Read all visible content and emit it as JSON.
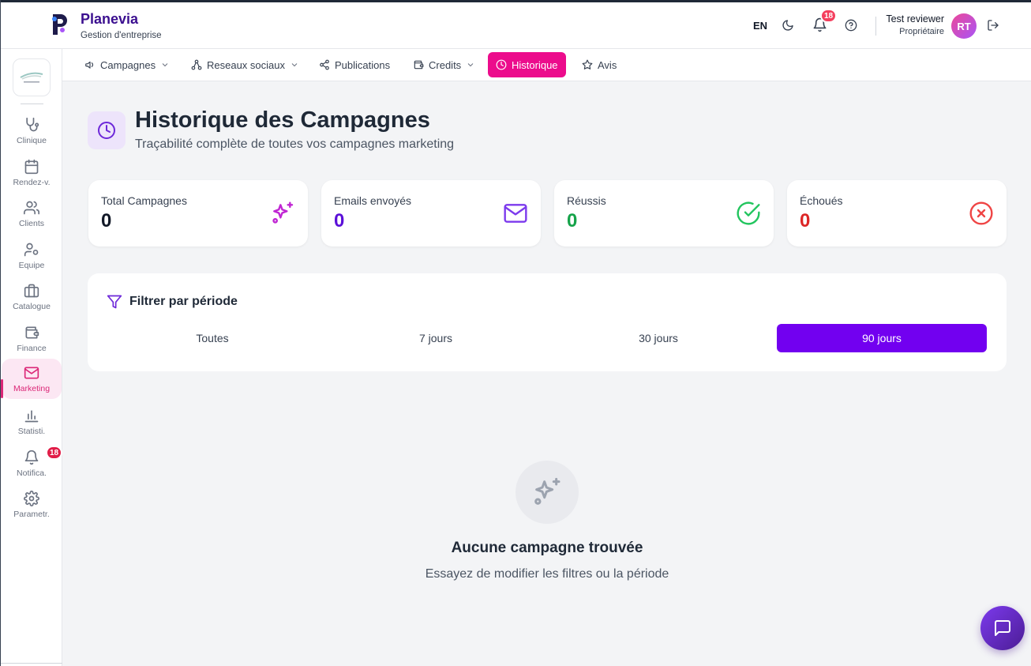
{
  "header": {
    "brand_name": "Planevia",
    "brand_sub": "Gestion d'entreprise",
    "lang": "EN",
    "notif_count": "18",
    "user_name": "Test reviewer",
    "user_role": "Propriétaire",
    "avatar_initials": "RT"
  },
  "sidebar": {
    "items": [
      {
        "label": "Clinique",
        "icon": "stethoscope-icon"
      },
      {
        "label": "Rendez-v.",
        "icon": "calendar-icon"
      },
      {
        "label": "Clients",
        "icon": "users-icon"
      },
      {
        "label": "Equipe",
        "icon": "user-cog-icon"
      },
      {
        "label": "Catalogue",
        "icon": "briefcase-icon"
      },
      {
        "label": "Finance",
        "icon": "wallet-icon"
      },
      {
        "label": "Marketing",
        "icon": "mail-icon"
      },
      {
        "label": "Statisti.",
        "icon": "bar-chart-icon"
      },
      {
        "label": "Notifica.",
        "icon": "bell-icon"
      },
      {
        "label": "Parametr.",
        "icon": "gear-icon"
      }
    ],
    "active": "Marketing",
    "notif_badge": "18"
  },
  "tabs": [
    {
      "label": "Campagnes",
      "icon": "megaphone-icon",
      "dropdown": true
    },
    {
      "label": "Reseaux sociaux",
      "icon": "network-icon",
      "dropdown": true
    },
    {
      "label": "Publications",
      "icon": "share-icon",
      "dropdown": false
    },
    {
      "label": "Credits",
      "icon": "wallet-icon",
      "dropdown": true
    },
    {
      "label": "Historique",
      "icon": "clock-icon",
      "dropdown": false,
      "active": true
    },
    {
      "label": "Avis",
      "icon": "star-icon",
      "dropdown": false
    }
  ],
  "page": {
    "title": "Historique des Campagnes",
    "subtitle": "Traçabilité complète de toutes vos campagnes marketing"
  },
  "stats": [
    {
      "label": "Total Campagnes",
      "value": "0",
      "color": "#111827",
      "icon": "sparkles-icon",
      "icon_color": "#c026d3"
    },
    {
      "label": "Emails envoyés",
      "value": "0",
      "color": "#5b10d8",
      "icon": "mail-icon",
      "icon_color": "#7c3aed"
    },
    {
      "label": "Réussis",
      "value": "0",
      "color": "#16a34a",
      "icon": "check-circle-icon",
      "icon_color": "#22c55e"
    },
    {
      "label": "Échoués",
      "value": "0",
      "color": "#dc2626",
      "icon": "x-circle-icon",
      "icon_color": "#ef4444"
    }
  ],
  "filter": {
    "title": "Filtrer par période",
    "options": [
      "Toutes",
      "7 jours",
      "30 jours",
      "90 jours"
    ],
    "selected": "90 jours"
  },
  "empty": {
    "title": "Aucune campagne trouvée",
    "subtitle": "Essayez de modifier les filtres ou la période"
  },
  "colors": {
    "brand": "#3b0f8f",
    "accent_pink": "#ec0c8c",
    "accent_purple": "#7200f0"
  }
}
